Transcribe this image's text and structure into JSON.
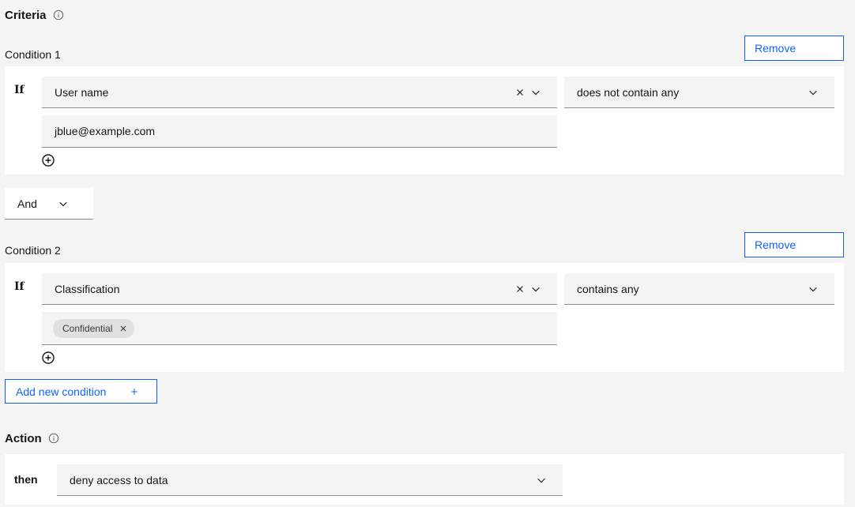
{
  "criteria": {
    "title": "Criteria",
    "conditions": [
      {
        "label": "Condition 1",
        "remove_label": "Remove",
        "if_label": "If",
        "attribute": "User name",
        "operator": "does not contain any",
        "value_input": "jblue@example.com"
      },
      {
        "label": "Condition 2",
        "remove_label": "Remove",
        "if_label": "If",
        "attribute": "Classification",
        "operator": "contains any",
        "tags": [
          "Confidential"
        ]
      }
    ],
    "conjunction": "And",
    "add_condition_label": "Add new condition"
  },
  "action": {
    "title": "Action",
    "then_label": "then",
    "value": "deny access to data"
  },
  "colors": {
    "accent": "#0f62fe",
    "page_bg": "#f4f4f4",
    "card_bg": "#ffffff",
    "field_bg": "#f4f4f4",
    "tag_bg": "#e0e0e0"
  },
  "icons": {
    "info": "info-circle-icon",
    "clear": "close-icon",
    "dropdown": "chevron-down-icon",
    "add_value": "add-circle-icon",
    "add": "plus-icon"
  }
}
